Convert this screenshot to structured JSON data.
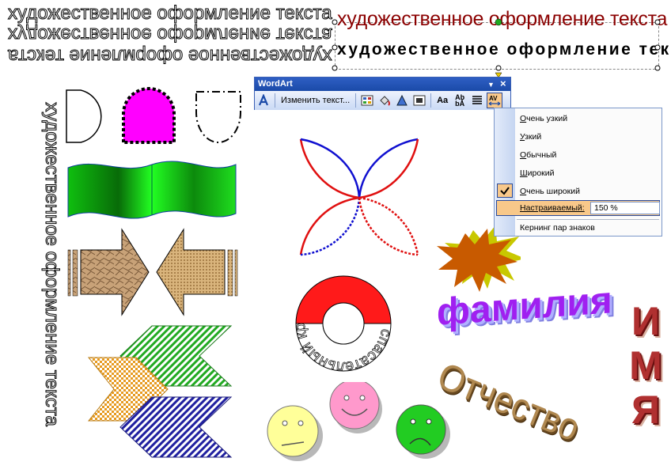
{
  "wordart_text": "художественное оформление текста",
  "toolbar": {
    "title": "WordArt",
    "edit_text_label": "Изменить текст...",
    "dropdown_arrow": "▼",
    "close_glyph": "×"
  },
  "spacing_menu": {
    "items": [
      {
        "label": "Очень узкий",
        "underline": "О",
        "rest": "чень узкий"
      },
      {
        "label": "Узкий",
        "underline": "У",
        "rest": "зкий"
      },
      {
        "label": "Обычный",
        "underline": "О",
        "rest": "бычный"
      },
      {
        "label": "Широкий",
        "underline": "Ш",
        "rest": "ирокий"
      },
      {
        "label": "Очень широкий",
        "underline": "О",
        "rest": "чень широкий",
        "checked": true
      }
    ],
    "custom_label": "Настраиваемый:",
    "custom_value": "150 %",
    "kerning_label": "Кернинг пар знаков"
  },
  "art": {
    "ring_text": "спасательный круг",
    "surname": "фамилия",
    "name_letters": [
      "И",
      "М",
      "Я"
    ],
    "patronymic": "Отчество"
  },
  "colors": {
    "title_bar": "#1f4fb0",
    "red_text": "#8b0000",
    "magenta": "#ff00ff",
    "green": "#22bb22",
    "menu_highlight": "#f8c88a"
  }
}
